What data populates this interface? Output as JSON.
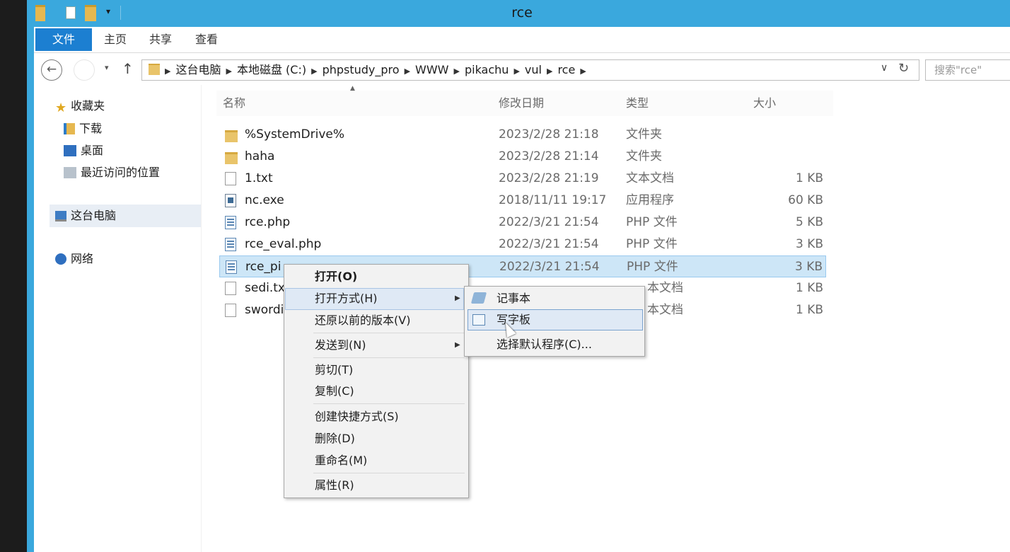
{
  "window": {
    "title": "rce"
  },
  "ribbon": {
    "tabs": [
      "文件",
      "主页",
      "共享",
      "查看"
    ]
  },
  "address": {
    "segments": [
      "这台电脑",
      "本地磁盘 (C:)",
      "phpstudy_pro",
      "WWW",
      "pikachu",
      "vul",
      "rce"
    ],
    "search_placeholder": "搜索\"rce\""
  },
  "sidebar": {
    "items": [
      {
        "label": "收藏夹",
        "icon": "star-icon"
      },
      {
        "label": "下载",
        "icon": "download-folder-icon"
      },
      {
        "label": "桌面",
        "icon": "desktop-icon"
      },
      {
        "label": "最近访问的位置",
        "icon": "recent-places-icon"
      },
      {
        "label": "这台电脑",
        "icon": "computer-icon"
      },
      {
        "label": "网络",
        "icon": "network-icon"
      }
    ]
  },
  "columns": {
    "name": "名称",
    "date": "修改日期",
    "type": "类型",
    "size": "大小"
  },
  "files": [
    {
      "name": "%SystemDrive%",
      "date": "2023/2/28 21:18",
      "type": "文件夹",
      "size": "",
      "icon": "folder-icon"
    },
    {
      "name": "haha",
      "date": "2023/2/28 21:14",
      "type": "文件夹",
      "size": "",
      "icon": "folder-icon"
    },
    {
      "name": "1.txt",
      "date": "2023/2/28 21:19",
      "type": "文本文档",
      "size": "1 KB",
      "icon": "text-file-icon"
    },
    {
      "name": "nc.exe",
      "date": "2018/11/11 19:17",
      "type": "应用程序",
      "size": "60 KB",
      "icon": "exe-file-icon"
    },
    {
      "name": "rce.php",
      "date": "2022/3/21 21:54",
      "type": "PHP 文件",
      "size": "5 KB",
      "icon": "php-file-icon"
    },
    {
      "name": "rce_eval.php",
      "date": "2022/3/21 21:54",
      "type": "PHP 文件",
      "size": "3 KB",
      "icon": "php-file-icon"
    },
    {
      "name": "rce_pi",
      "date": "2022/3/21 21:54",
      "type": "PHP 文件",
      "size": "3 KB",
      "icon": "php-file-icon"
    },
    {
      "name": "sedi.tx",
      "date": "",
      "type": "本文档",
      "size": "1 KB",
      "icon": "text-file-icon"
    },
    {
      "name": "swordi",
      "date": "",
      "type": "本文档",
      "size": "1 KB",
      "icon": "text-file-icon"
    }
  ],
  "context_menu": {
    "open": "打开(O)",
    "open_with": "打开方式(H)",
    "restore": "还原以前的版本(V)",
    "send_to": "发送到(N)",
    "cut": "剪切(T)",
    "copy": "复制(C)",
    "create_shortcut": "创建快捷方式(S)",
    "delete": "删除(D)",
    "rename": "重命名(M)",
    "properties": "属性(R)"
  },
  "submenu": {
    "notepad": "记事本",
    "wordpad": "写字板",
    "choose_default": "选择默认程序(C)..."
  },
  "colors": {
    "titlebar": "#3aa8dd",
    "file_tab": "#1c7fd1",
    "selection": "#cde6f7"
  }
}
